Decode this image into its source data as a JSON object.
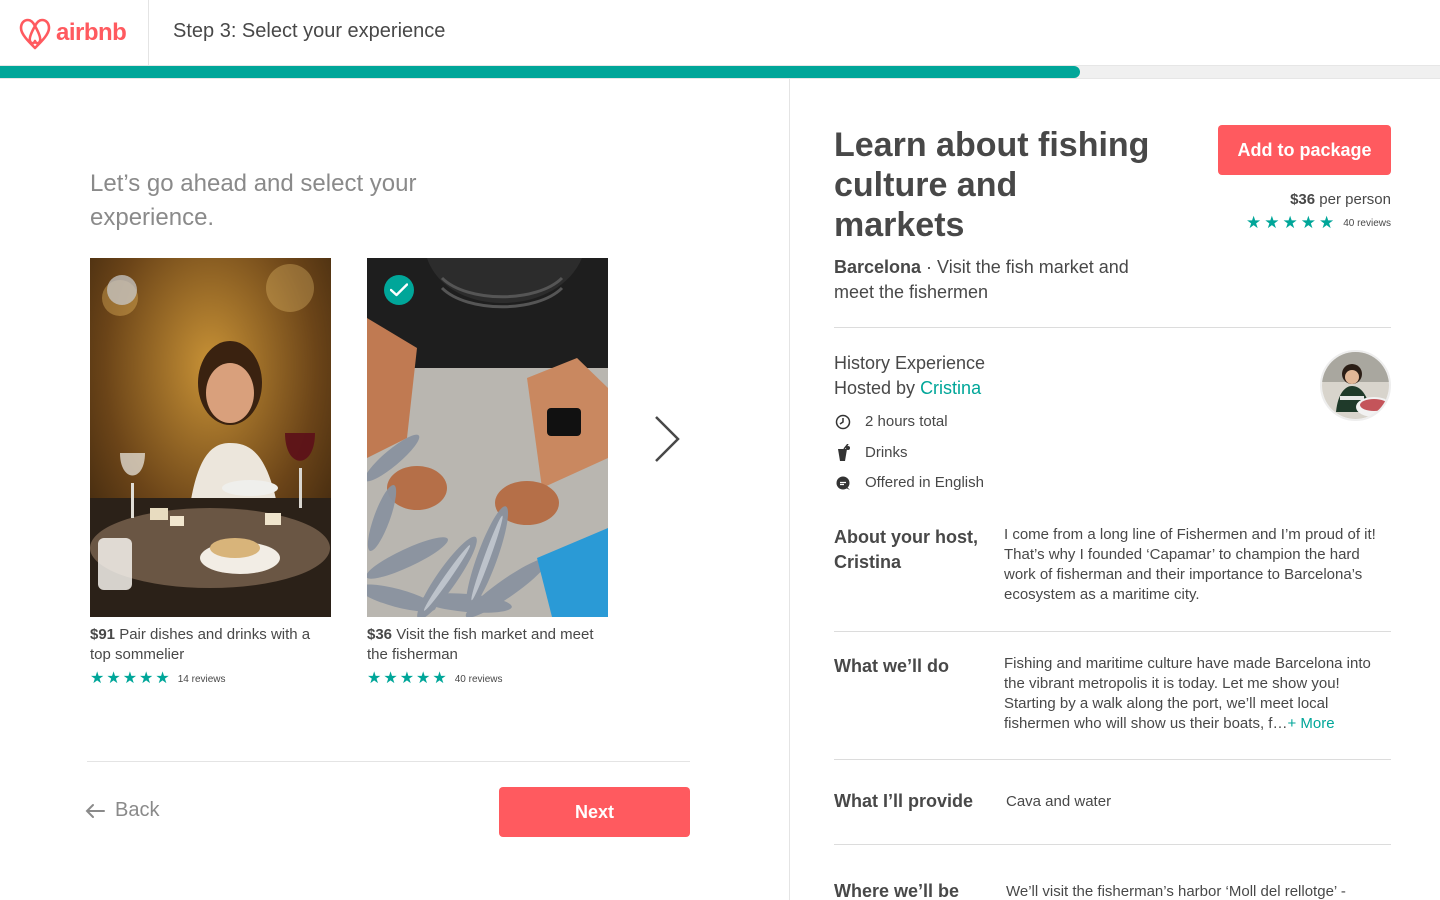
{
  "header": {
    "brand": "airbnb",
    "step_title": "Step 3: Select your experience",
    "progress_percent": 75
  },
  "colors": {
    "brand": "#FF5A5F",
    "accent": "#00A699",
    "text": "#484848"
  },
  "left": {
    "intro": "Let’s go ahead and select your experience.",
    "cards": [
      {
        "price": "$91",
        "title": "Pair dishes and drinks with a top sommelier",
        "rating": 5,
        "reviews": "14 reviews",
        "selected": false
      },
      {
        "price": "$36",
        "title": "Visit the fish market and meet the fisherman",
        "rating": 5,
        "reviews": "40 reviews",
        "selected": true
      }
    ],
    "back_label": "Back",
    "next_label": "Next"
  },
  "detail": {
    "title": "Learn about fishing culture and markets",
    "add_label": "Add to package",
    "price": "$36",
    "price_unit": "per person",
    "rating": 5,
    "reviews": "40 reviews",
    "city": "Barcelona",
    "tagline": "Visit the fish market and meet the fishermen",
    "experience_type": "History Experience",
    "hosted_by_label": "Hosted by",
    "host_name": "Cristina",
    "facts": [
      {
        "icon": "clock-icon",
        "label": "2 hours total"
      },
      {
        "icon": "drink-icon",
        "label": "Drinks"
      },
      {
        "icon": "chat-bubble-icon",
        "label": "Offered in English"
      }
    ],
    "sections": [
      {
        "label": "About your host, Cristina",
        "body": "I come from a long line of Fishermen and I’m proud of it! That’s why I founded ‘Capamar’ to champion the hard work of fisherman and their importance to Barcelona’s ecosystem as a maritime city."
      },
      {
        "label": "What we’ll do",
        "body": "Fishing and maritime culture have made Barcelona into the vibrant metropolis it is today. Let me show you! Starting by a walk along the port, we’ll meet local fishermen who will show us their boats, f…",
        "more": "+ More"
      },
      {
        "label": "What I’ll provide",
        "body": "Cava and water"
      },
      {
        "label": "Where we’ll be",
        "body": "We’ll visit the fisherman’s harbor ‘Moll del rellotge’ -"
      }
    ]
  }
}
